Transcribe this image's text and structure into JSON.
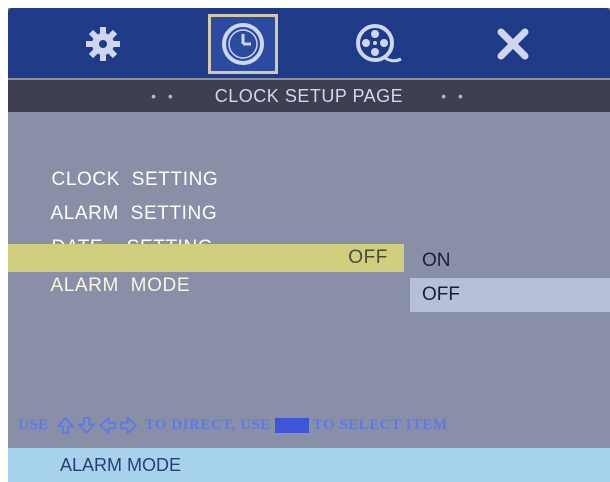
{
  "header": {
    "icons": [
      "gear-icon",
      "clock-icon",
      "film-reel-icon",
      "close-icon"
    ],
    "selected_icon": "clock-icon"
  },
  "title_bar": {
    "dots_left": "• •",
    "title": "CLOCK SETUP  PAGE",
    "dots_right": "• •"
  },
  "menu": {
    "items": [
      {
        "label": "CLOCK  SETTING",
        "value": ""
      },
      {
        "label": "ALARM  SETTING",
        "value": ""
      },
      {
        "label": "DATE    SETTING",
        "value": ""
      },
      {
        "label": "ALARM  MODE",
        "value": "OFF"
      }
    ],
    "active_index": 3
  },
  "submenu": {
    "options": [
      "ON",
      "OFF"
    ],
    "selected": "OFF"
  },
  "hint": {
    "prefix": "USE",
    "middle": "TO DIRECT, USE",
    "suffix": "TO SELECT ITEM"
  },
  "status_bar": {
    "text": "ALARM MODE"
  },
  "colors": {
    "top_bar": "#1f3a86",
    "panel": "#8a8fa8",
    "highlight": "#cfcf7e",
    "submenu_selected": "#b6c0d8",
    "hint": "#5d79e6",
    "status_bar": "#a7d2ec"
  }
}
